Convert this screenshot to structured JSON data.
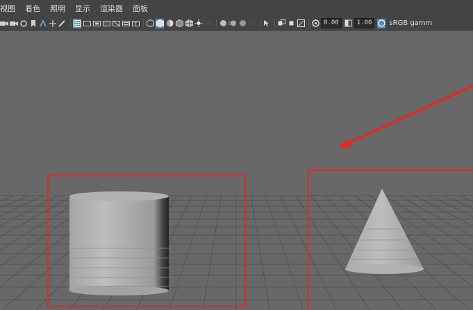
{
  "menubar": {
    "items": [
      {
        "label": "视图"
      },
      {
        "label": "着色"
      },
      {
        "label": "照明"
      },
      {
        "label": "显示"
      },
      {
        "label": "渲染器"
      },
      {
        "label": "面板"
      }
    ]
  },
  "toolbar": {
    "exposure_value": "0.00",
    "gamma_value": "1.00",
    "color_space_label": "sRGB gamm"
  },
  "viewport": {
    "background_color": "#686868",
    "grid_color": "#4e4e4e",
    "annotation_color": "#e02a22",
    "objects": [
      {
        "name": "cylinder"
      },
      {
        "name": "cone"
      }
    ]
  }
}
